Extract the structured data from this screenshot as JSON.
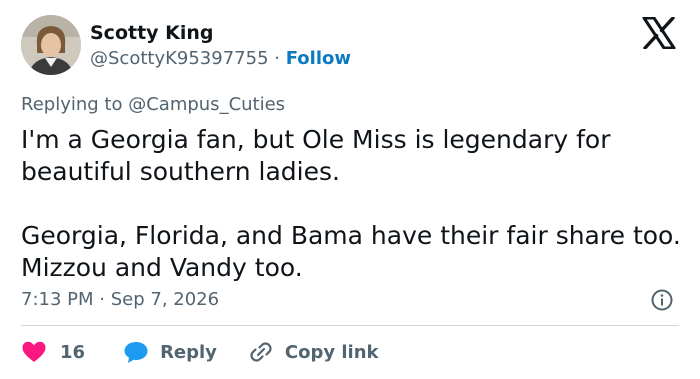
{
  "author": {
    "name": "Scotty King",
    "handle": "@ScottyK95397755",
    "separator": "·",
    "follow_label": "Follow"
  },
  "reply_context": {
    "prefix": "Replying to",
    "mention": "@Campus_Cuties"
  },
  "tweet": {
    "text": "I'm a Georgia fan, but Ole Miss is legendary for beautiful southern ladies.\n\nGeorgia, Florida, and Bama have their fair share too.  Mizzou and Vandy too.",
    "time": "7:13 PM",
    "separator": "·",
    "date": "Sep 7, 2026"
  },
  "actions": {
    "like_count": "16",
    "reply_label": "Reply",
    "copy_link_label": "Copy link"
  },
  "colors": {
    "heart": "#f91880",
    "reply_bubble": "#1d9bf0",
    "follow": "#0c7abf",
    "muted": "#536471"
  },
  "icons": [
    "x-logo-icon",
    "info-icon",
    "heart-icon",
    "reply-bubble-icon",
    "link-icon"
  ]
}
